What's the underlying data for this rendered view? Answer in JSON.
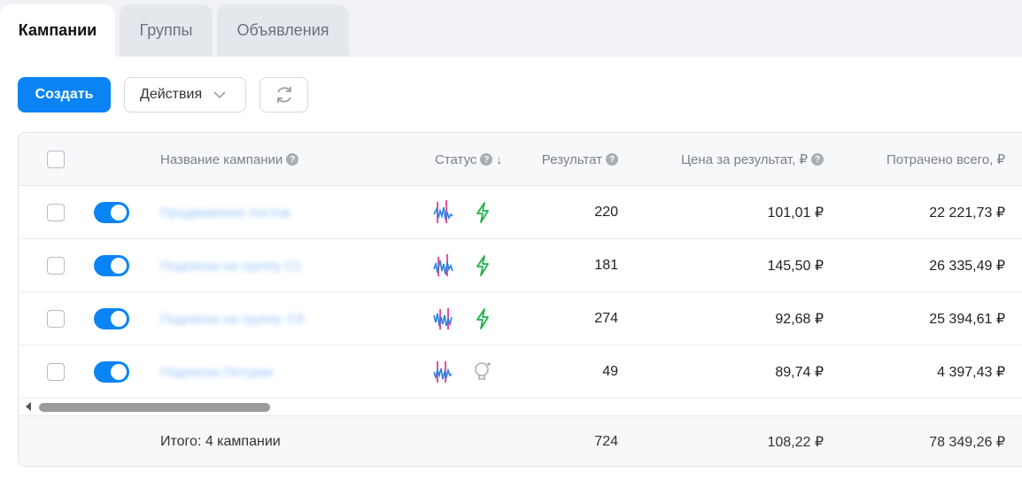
{
  "tabs": [
    {
      "label": "Кампании",
      "active": true
    },
    {
      "label": "Группы",
      "active": false
    },
    {
      "label": "Объявления",
      "active": false
    }
  ],
  "toolbar": {
    "create_label": "Создать",
    "actions_label": "Действия",
    "refresh_icon": "refresh-icon"
  },
  "table": {
    "headers": {
      "name": "Название кампании",
      "status": "Статус",
      "result": "Результат",
      "price": "Цена за результат, ₽",
      "spent": "Потрачено всего, ₽"
    },
    "rows": [
      {
        "name": "Продвижение постов",
        "enabled": true,
        "status_icon": "lightning-icon",
        "result": "220",
        "price": "101,01 ₽",
        "spent": "22 221,73 ₽"
      },
      {
        "name": "Подписка на группу С1",
        "enabled": true,
        "status_icon": "lightning-icon",
        "result": "181",
        "price": "145,50 ₽",
        "spent": "26 335,49 ₽"
      },
      {
        "name": "Подписка на группу. С6",
        "enabled": true,
        "status_icon": "lightning-icon",
        "result": "274",
        "price": "92,68 ₽",
        "spent": "25 394,61 ₽"
      },
      {
        "name": "Подписка Потурки",
        "enabled": true,
        "status_icon": "lightbulb-icon",
        "result": "49",
        "price": "89,74 ₽",
        "spent": "4 397,43 ₽"
      }
    ],
    "footer": {
      "label": "Итого: 4 кампании",
      "result": "724",
      "price": "108,22 ₽",
      "spent": "78 349,26 ₽"
    }
  },
  "colors": {
    "accent": "#0a84f5",
    "status_active": "#1fb14a",
    "status_inactive": "#a9aeb5"
  }
}
